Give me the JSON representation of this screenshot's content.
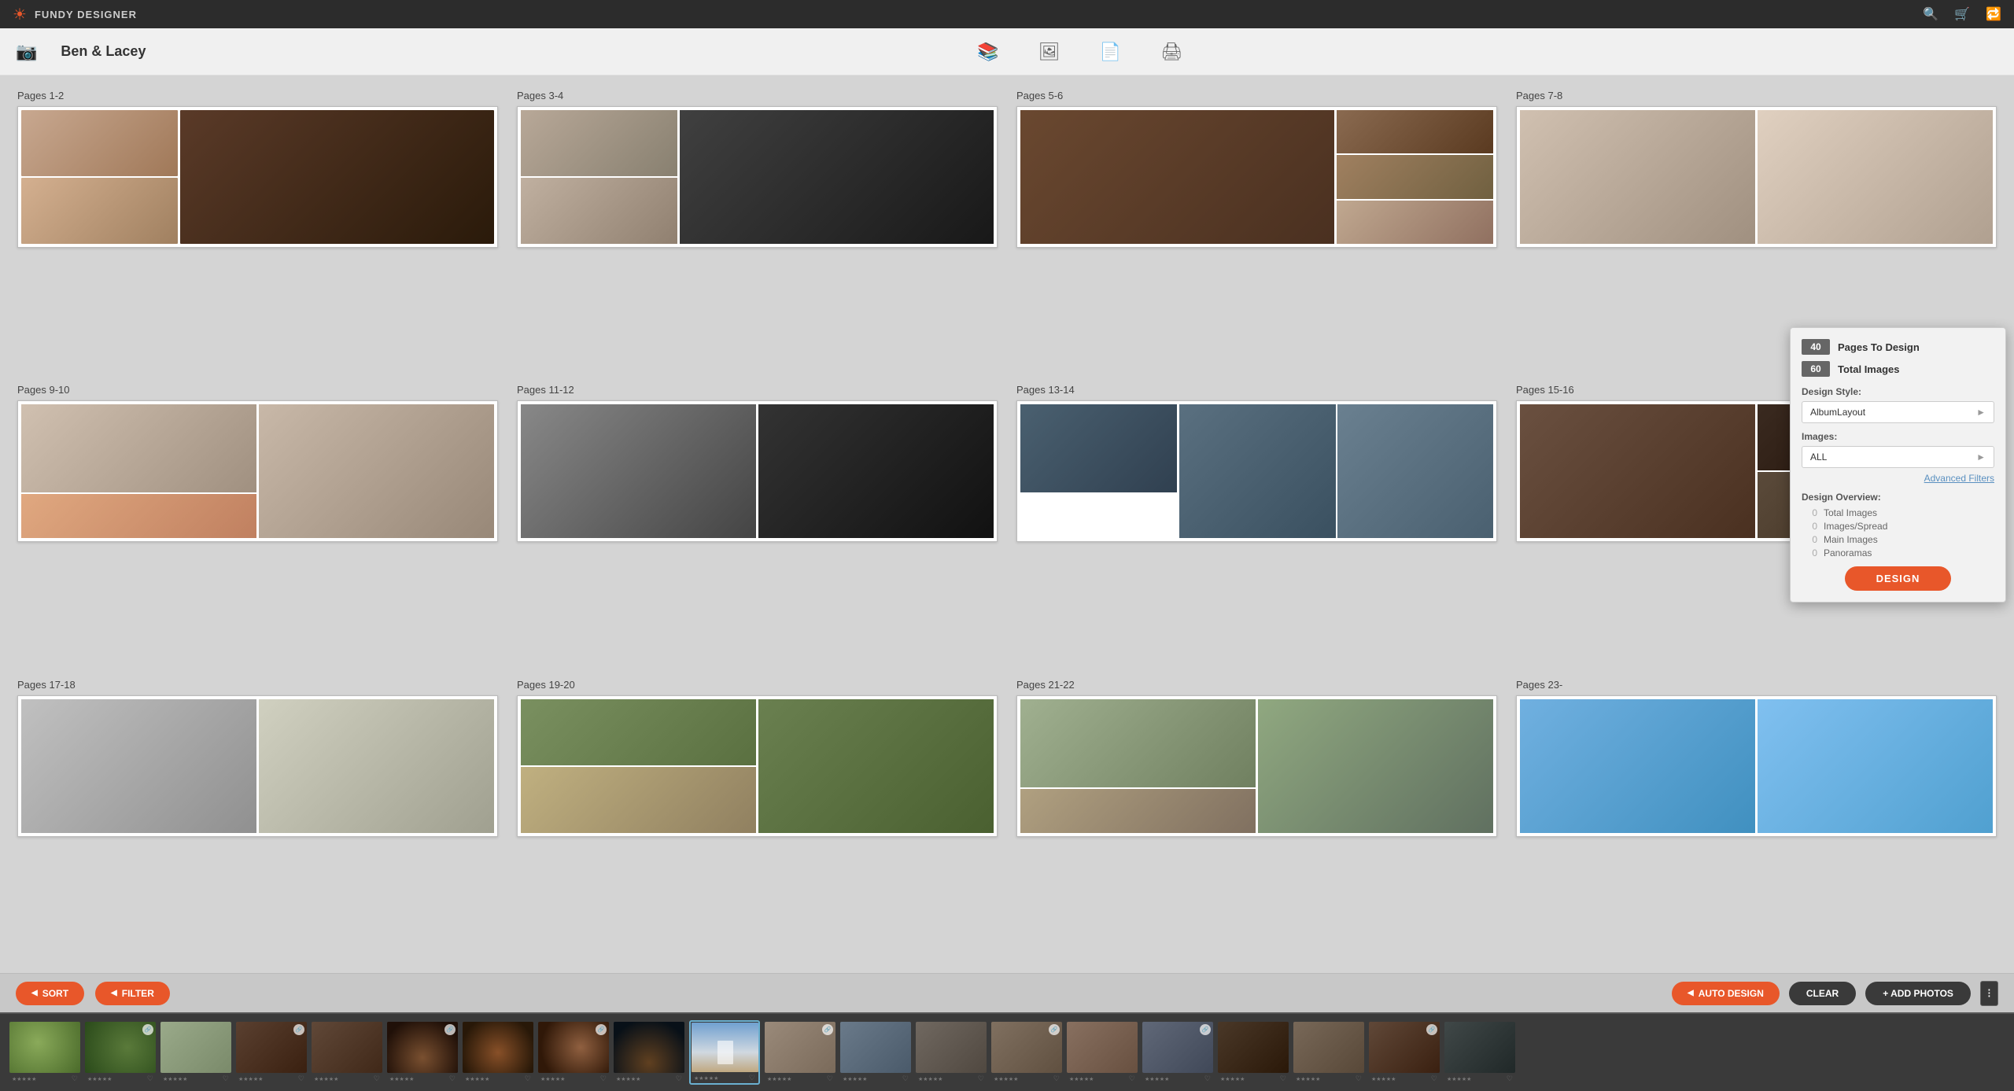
{
  "app": {
    "title": "FUNDY DESIGNER",
    "project_name": "Ben & Lacey"
  },
  "topbar": {
    "title": "FUNDY DESIGNER",
    "icons": [
      "search",
      "cart",
      "export"
    ]
  },
  "projectbar": {
    "project_name": "Ben & Lacey",
    "tools": [
      "album-design",
      "wall-art",
      "card",
      "print"
    ]
  },
  "spreads": [
    {
      "id": "spread-1-2",
      "label": "Pages 1-2",
      "layout": "two-up"
    },
    {
      "id": "spread-3-4",
      "label": "Pages 3-4",
      "layout": "two-up"
    },
    {
      "id": "spread-5-6",
      "label": "Pages 5-6",
      "layout": "two-up"
    },
    {
      "id": "spread-7-8",
      "label": "Pages 7-8",
      "layout": "two-up"
    },
    {
      "id": "spread-9-10",
      "label": "Pages 9-10",
      "layout": "two-up"
    },
    {
      "id": "spread-11-12",
      "label": "Pages 11-12",
      "layout": "two-up"
    },
    {
      "id": "spread-13-14",
      "label": "Pages 13-14",
      "layout": "two-up"
    },
    {
      "id": "spread-15-16",
      "label": "Pages 15-16",
      "layout": "two-up"
    },
    {
      "id": "spread-17-18",
      "label": "Pages 17-18",
      "layout": "two-up"
    },
    {
      "id": "spread-19-20",
      "label": "Pages 19-20",
      "layout": "two-up"
    },
    {
      "id": "spread-21-22",
      "label": "Pages 21-22",
      "layout": "two-up"
    },
    {
      "id": "spread-23-xx",
      "label": "Pages 23-",
      "layout": "two-up"
    }
  ],
  "toolbar": {
    "sort_label": "SORT",
    "filter_label": "FILTER",
    "auto_design_label": "AUTO DESIGN",
    "clear_label": "CLEAR",
    "add_photos_label": "+ ADD PHOTOS"
  },
  "popup": {
    "pages_to_design_label": "Pages To Design",
    "pages_count": "40",
    "total_images_label": "Total Images",
    "total_images_count": "60",
    "design_style_label": "Design Style:",
    "design_style_value": "AlbumLayout",
    "images_label": "Images:",
    "images_value": "ALL",
    "advanced_filters_label": "Advanced Filters",
    "overview_label": "Design Overview:",
    "overview_items": [
      {
        "count": "0",
        "label": "Total Images"
      },
      {
        "count": "0",
        "label": "Images/Spread"
      },
      {
        "count": "0",
        "label": "Main Images"
      },
      {
        "count": "0",
        "label": "Panoramas"
      }
    ],
    "design_button_label": "DESIGN"
  },
  "filmstrip": {
    "thumbs": [
      {
        "id": 1,
        "color": "#6a8a4a",
        "selected": false
      },
      {
        "id": 2,
        "color": "#4a6a3a",
        "selected": false
      },
      {
        "id": 3,
        "color": "#8a9a7a",
        "selected": false
      },
      {
        "id": 4,
        "color": "#5a4a3a",
        "selected": false
      },
      {
        "id": 5,
        "color": "#6a5040",
        "selected": false
      },
      {
        "id": 6,
        "color": "#7a6050",
        "selected": false
      },
      {
        "id": 7,
        "color": "#4a5060",
        "selected": false
      },
      {
        "id": 8,
        "color": "#607080",
        "selected": false
      },
      {
        "id": 9,
        "color": "#8a6a50",
        "selected": false
      },
      {
        "id": 10,
        "color": "#4a6a8a",
        "selected": true
      },
      {
        "id": 11,
        "color": "#9a8a7a",
        "selected": false
      },
      {
        "id": 12,
        "color": "#506070",
        "selected": false
      },
      {
        "id": 13,
        "color": "#7a8070",
        "selected": false
      },
      {
        "id": 14,
        "color": "#6a7060",
        "selected": false
      },
      {
        "id": 15,
        "color": "#8a7a6a",
        "selected": false
      },
      {
        "id": 16,
        "color": "#506878",
        "selected": false
      },
      {
        "id": 17,
        "color": "#604838",
        "selected": false
      },
      {
        "id": 18,
        "color": "#7a5a4a",
        "selected": false
      },
      {
        "id": 19,
        "color": "#4a3828",
        "selected": false
      },
      {
        "id": 20,
        "color": "#685848",
        "selected": false
      },
      {
        "id": 21,
        "color": "#7a6858",
        "selected": false
      }
    ]
  },
  "colors": {
    "accent": "#e8572a",
    "topbar_bg": "#2c2c2c",
    "projectbar_bg": "#f0f0f0",
    "main_bg": "#d4d4d4",
    "filmstrip_bg": "#3a3a3a",
    "selected_border": "#6ab0d0"
  }
}
